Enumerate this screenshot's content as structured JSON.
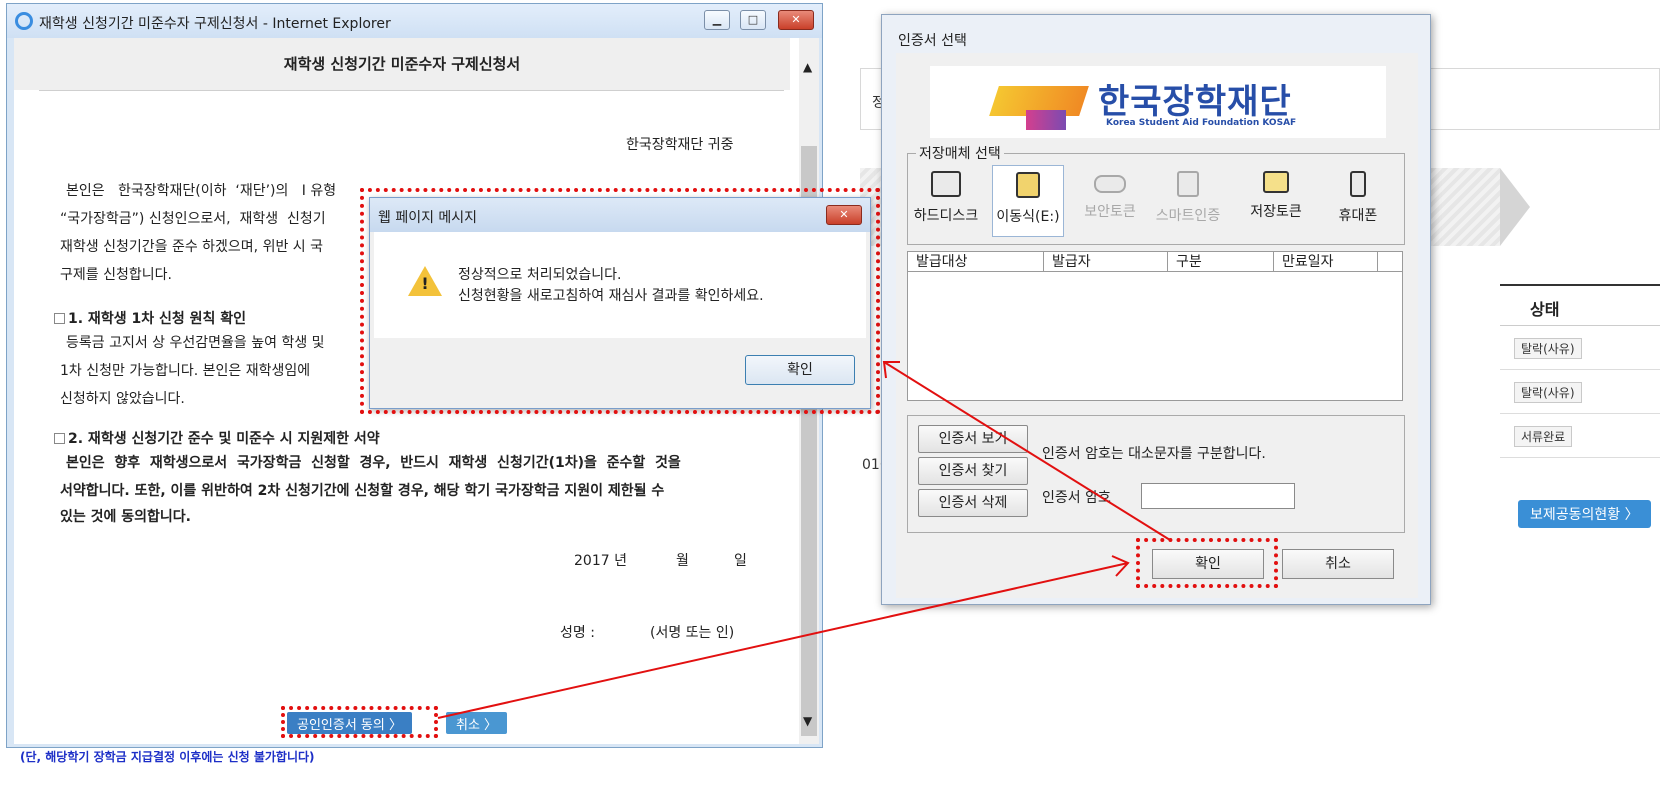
{
  "background": {
    "info_text": "정정보가",
    "table_header": "상태",
    "rows": [
      "탈락(사유)",
      "탈락(사유)",
      "서류완료"
    ],
    "year_text": "016년 1학",
    "link_text": "보제공동의현황 〉"
  },
  "ie_window": {
    "title": "재학생 신청기간 미준수자 구제신청서 - Internet Explorer",
    "header": "재학생 신청기간 미준수자 구제신청서",
    "addressee": "한국장학재단 귀중",
    "para1": [
      "본인은   한국장학재단(이하  ‘재단’)의   I 유형",
      "“국가장학금”) 신청인으로서,  재학생  신청기",
      "재학생 신청기간을 준수 하겠으며, 위반 시 국",
      "구제를 신청합니다."
    ],
    "sec1_title": "1. 재학생 1차 신청 원칙 확인",
    "sec1_body": [
      "등록금 고지서 상 우선감면율을 높여 학생 및",
      "1차 신청만 가능합니다. 본인은 재학생임에",
      "신청하지 않았습니다."
    ],
    "sec2_title": "2. 재학생 신청기간 준수 및 미준수 시 지원제한 서약",
    "sec2_body": [
      "본인은  향후  재학생으로서  국가장학금  신청할  경우,  반드시  재학생  신청기간(1차)을  준수할  것을",
      "서약합니다. 또한, 이를 위반하여 2차 신청기간에 신청할 경우, 해당 학기 국가장학금 지원이 제한될 수",
      "있는 것에 동의합니다."
    ],
    "date_year": "2017 년",
    "date_month": "월",
    "date_day": "일",
    "sign_label": "성명 :",
    "sign_hint": "(서명 또는 인)",
    "btn_cert": "공인인증서 동의 〉",
    "btn_cancel": "취소 〉",
    "footnote": "(단, 해당학기 장학금 지급결정 이후에는 신청 불가합니다)"
  },
  "message_dialog": {
    "title": "웹 페이지 메시지",
    "line1": "정상적으로 처리되었습니다.",
    "line2": "신청현황을 새로고침하여 재심사 결과를 확인하세요.",
    "ok": "확인"
  },
  "cert_dialog": {
    "title": "인증서 선택",
    "logo_text": "한국장학재단",
    "logo_sub": "Korea Student Aid Foundation KOSAF",
    "storage_legend": "저장매체 선택",
    "media": [
      {
        "label": "하드디스크",
        "icon": "harddisk-icon"
      },
      {
        "label": "이동식(E:)",
        "icon": "usb-drive-icon"
      },
      {
        "label": "보안토큰",
        "icon": "security-token-icon"
      },
      {
        "label": "스마트인증",
        "icon": "smart-auth-icon"
      },
      {
        "label": "저장토큰",
        "icon": "storage-token-icon"
      },
      {
        "label": "휴대폰",
        "icon": "mobile-phone-icon"
      }
    ],
    "columns": [
      "발급대상",
      "발급자",
      "구분",
      "만료일자"
    ],
    "btn_view": "인증서 보기",
    "btn_find": "인증서 찾기",
    "btn_delete": "인증서 삭제",
    "pw_note": "인증서 암호는 대소문자를 구분합니다.",
    "pw_label": "인증서 암호",
    "pw_value": "",
    "ok": "확인",
    "cancel": "취소"
  },
  "colors": {
    "highlight": "#e21010",
    "accent": "#3a7fc4",
    "logo_blue": "#274ea8"
  }
}
